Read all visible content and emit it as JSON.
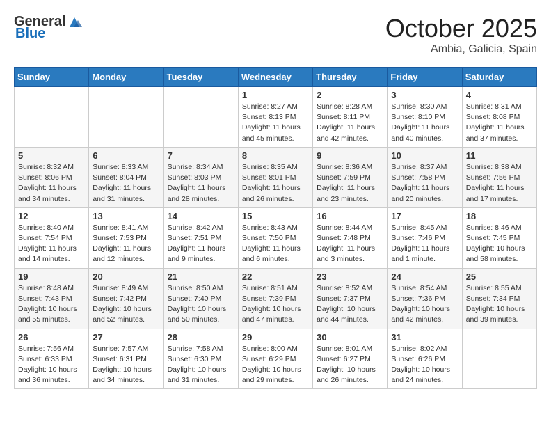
{
  "header": {
    "logo_general": "General",
    "logo_blue": "Blue",
    "month_year": "October 2025",
    "location": "Ambia, Galicia, Spain"
  },
  "weekdays": [
    "Sunday",
    "Monday",
    "Tuesday",
    "Wednesday",
    "Thursday",
    "Friday",
    "Saturday"
  ],
  "weeks": [
    [
      {
        "day": "",
        "sunrise": "",
        "sunset": "",
        "daylight": ""
      },
      {
        "day": "",
        "sunrise": "",
        "sunset": "",
        "daylight": ""
      },
      {
        "day": "",
        "sunrise": "",
        "sunset": "",
        "daylight": ""
      },
      {
        "day": "1",
        "sunrise": "8:27 AM",
        "sunset": "8:13 PM",
        "daylight": "11 hours and 45 minutes."
      },
      {
        "day": "2",
        "sunrise": "8:28 AM",
        "sunset": "8:11 PM",
        "daylight": "11 hours and 42 minutes."
      },
      {
        "day": "3",
        "sunrise": "8:30 AM",
        "sunset": "8:10 PM",
        "daylight": "11 hours and 40 minutes."
      },
      {
        "day": "4",
        "sunrise": "8:31 AM",
        "sunset": "8:08 PM",
        "daylight": "11 hours and 37 minutes."
      }
    ],
    [
      {
        "day": "5",
        "sunrise": "8:32 AM",
        "sunset": "8:06 PM",
        "daylight": "11 hours and 34 minutes."
      },
      {
        "day": "6",
        "sunrise": "8:33 AM",
        "sunset": "8:04 PM",
        "daylight": "11 hours and 31 minutes."
      },
      {
        "day": "7",
        "sunrise": "8:34 AM",
        "sunset": "8:03 PM",
        "daylight": "11 hours and 28 minutes."
      },
      {
        "day": "8",
        "sunrise": "8:35 AM",
        "sunset": "8:01 PM",
        "daylight": "11 hours and 26 minutes."
      },
      {
        "day": "9",
        "sunrise": "8:36 AM",
        "sunset": "7:59 PM",
        "daylight": "11 hours and 23 minutes."
      },
      {
        "day": "10",
        "sunrise": "8:37 AM",
        "sunset": "7:58 PM",
        "daylight": "11 hours and 20 minutes."
      },
      {
        "day": "11",
        "sunrise": "8:38 AM",
        "sunset": "7:56 PM",
        "daylight": "11 hours and 17 minutes."
      }
    ],
    [
      {
        "day": "12",
        "sunrise": "8:40 AM",
        "sunset": "7:54 PM",
        "daylight": "11 hours and 14 minutes."
      },
      {
        "day": "13",
        "sunrise": "8:41 AM",
        "sunset": "7:53 PM",
        "daylight": "11 hours and 12 minutes."
      },
      {
        "day": "14",
        "sunrise": "8:42 AM",
        "sunset": "7:51 PM",
        "daylight": "11 hours and 9 minutes."
      },
      {
        "day": "15",
        "sunrise": "8:43 AM",
        "sunset": "7:50 PM",
        "daylight": "11 hours and 6 minutes."
      },
      {
        "day": "16",
        "sunrise": "8:44 AM",
        "sunset": "7:48 PM",
        "daylight": "11 hours and 3 minutes."
      },
      {
        "day": "17",
        "sunrise": "8:45 AM",
        "sunset": "7:46 PM",
        "daylight": "11 hours and 1 minute."
      },
      {
        "day": "18",
        "sunrise": "8:46 AM",
        "sunset": "7:45 PM",
        "daylight": "10 hours and 58 minutes."
      }
    ],
    [
      {
        "day": "19",
        "sunrise": "8:48 AM",
        "sunset": "7:43 PM",
        "daylight": "10 hours and 55 minutes."
      },
      {
        "day": "20",
        "sunrise": "8:49 AM",
        "sunset": "7:42 PM",
        "daylight": "10 hours and 52 minutes."
      },
      {
        "day": "21",
        "sunrise": "8:50 AM",
        "sunset": "7:40 PM",
        "daylight": "10 hours and 50 minutes."
      },
      {
        "day": "22",
        "sunrise": "8:51 AM",
        "sunset": "7:39 PM",
        "daylight": "10 hours and 47 minutes."
      },
      {
        "day": "23",
        "sunrise": "8:52 AM",
        "sunset": "7:37 PM",
        "daylight": "10 hours and 44 minutes."
      },
      {
        "day": "24",
        "sunrise": "8:54 AM",
        "sunset": "7:36 PM",
        "daylight": "10 hours and 42 minutes."
      },
      {
        "day": "25",
        "sunrise": "8:55 AM",
        "sunset": "7:34 PM",
        "daylight": "10 hours and 39 minutes."
      }
    ],
    [
      {
        "day": "26",
        "sunrise": "7:56 AM",
        "sunset": "6:33 PM",
        "daylight": "10 hours and 36 minutes."
      },
      {
        "day": "27",
        "sunrise": "7:57 AM",
        "sunset": "6:31 PM",
        "daylight": "10 hours and 34 minutes."
      },
      {
        "day": "28",
        "sunrise": "7:58 AM",
        "sunset": "6:30 PM",
        "daylight": "10 hours and 31 minutes."
      },
      {
        "day": "29",
        "sunrise": "8:00 AM",
        "sunset": "6:29 PM",
        "daylight": "10 hours and 29 minutes."
      },
      {
        "day": "30",
        "sunrise": "8:01 AM",
        "sunset": "6:27 PM",
        "daylight": "10 hours and 26 minutes."
      },
      {
        "day": "31",
        "sunrise": "8:02 AM",
        "sunset": "6:26 PM",
        "daylight": "10 hours and 24 minutes."
      },
      {
        "day": "",
        "sunrise": "",
        "sunset": "",
        "daylight": ""
      }
    ]
  ],
  "labels": {
    "sunrise_prefix": "Sunrise: ",
    "sunset_prefix": "Sunset: ",
    "daylight_prefix": "Daylight: "
  }
}
